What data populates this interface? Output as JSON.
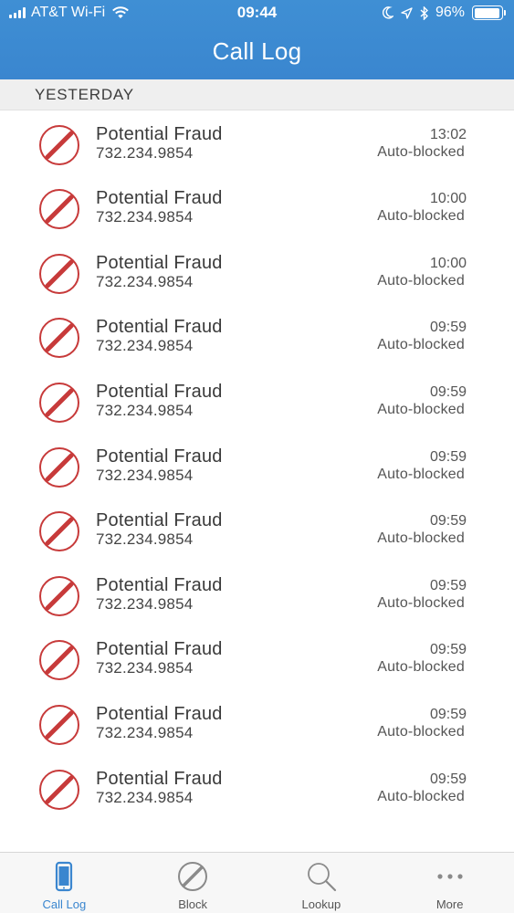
{
  "status_bar": {
    "carrier": "AT&T Wi-Fi",
    "time": "09:44",
    "battery": "96%",
    "battery_level": 0.96
  },
  "title": "Call Log",
  "section": "YESTERDAY",
  "calls": [
    {
      "name": "Potential Fraud",
      "number": "732.234.9854",
      "time": "",
      "status": "Auto-blocked"
    },
    {
      "name": "Potential Fraud",
      "number": "732.234.9854",
      "time": "13:02",
      "status": "Auto-blocked"
    },
    {
      "name": "Potential Fraud",
      "number": "732.234.9854",
      "time": "10:00",
      "status": "Auto-blocked"
    },
    {
      "name": "Potential Fraud",
      "number": "732.234.9854",
      "time": "10:00",
      "status": "Auto-blocked"
    },
    {
      "name": "Potential Fraud",
      "number": "732.234.9854",
      "time": "09:59",
      "status": "Auto-blocked"
    },
    {
      "name": "Potential Fraud",
      "number": "732.234.9854",
      "time": "09:59",
      "status": "Auto-blocked"
    },
    {
      "name": "Potential Fraud",
      "number": "732.234.9854",
      "time": "09:59",
      "status": "Auto-blocked"
    },
    {
      "name": "Potential Fraud",
      "number": "732.234.9854",
      "time": "09:59",
      "status": "Auto-blocked"
    },
    {
      "name": "Potential Fraud",
      "number": "732.234.9854",
      "time": "09:59",
      "status": "Auto-blocked"
    },
    {
      "name": "Potential Fraud",
      "number": "732.234.9854",
      "time": "09:59",
      "status": "Auto-blocked"
    },
    {
      "name": "Potential Fraud",
      "number": "732.234.9854",
      "time": "09:59",
      "status": "Auto-blocked"
    },
    {
      "name": "Potential Fraud",
      "number": "732.234.9854",
      "time": "09:59",
      "status": "Auto-blocked"
    }
  ],
  "tabs": [
    {
      "label": "Call Log",
      "icon": "phone-icon",
      "active": true
    },
    {
      "label": "Block",
      "icon": "block-icon",
      "active": false
    },
    {
      "label": "Lookup",
      "icon": "magnifier-icon",
      "active": false
    },
    {
      "label": "More",
      "icon": "more-dots-icon",
      "active": false
    }
  ],
  "colors": {
    "header": "#3a86cf",
    "block_red": "#c73a3a",
    "active_tab": "#3a86cf"
  }
}
